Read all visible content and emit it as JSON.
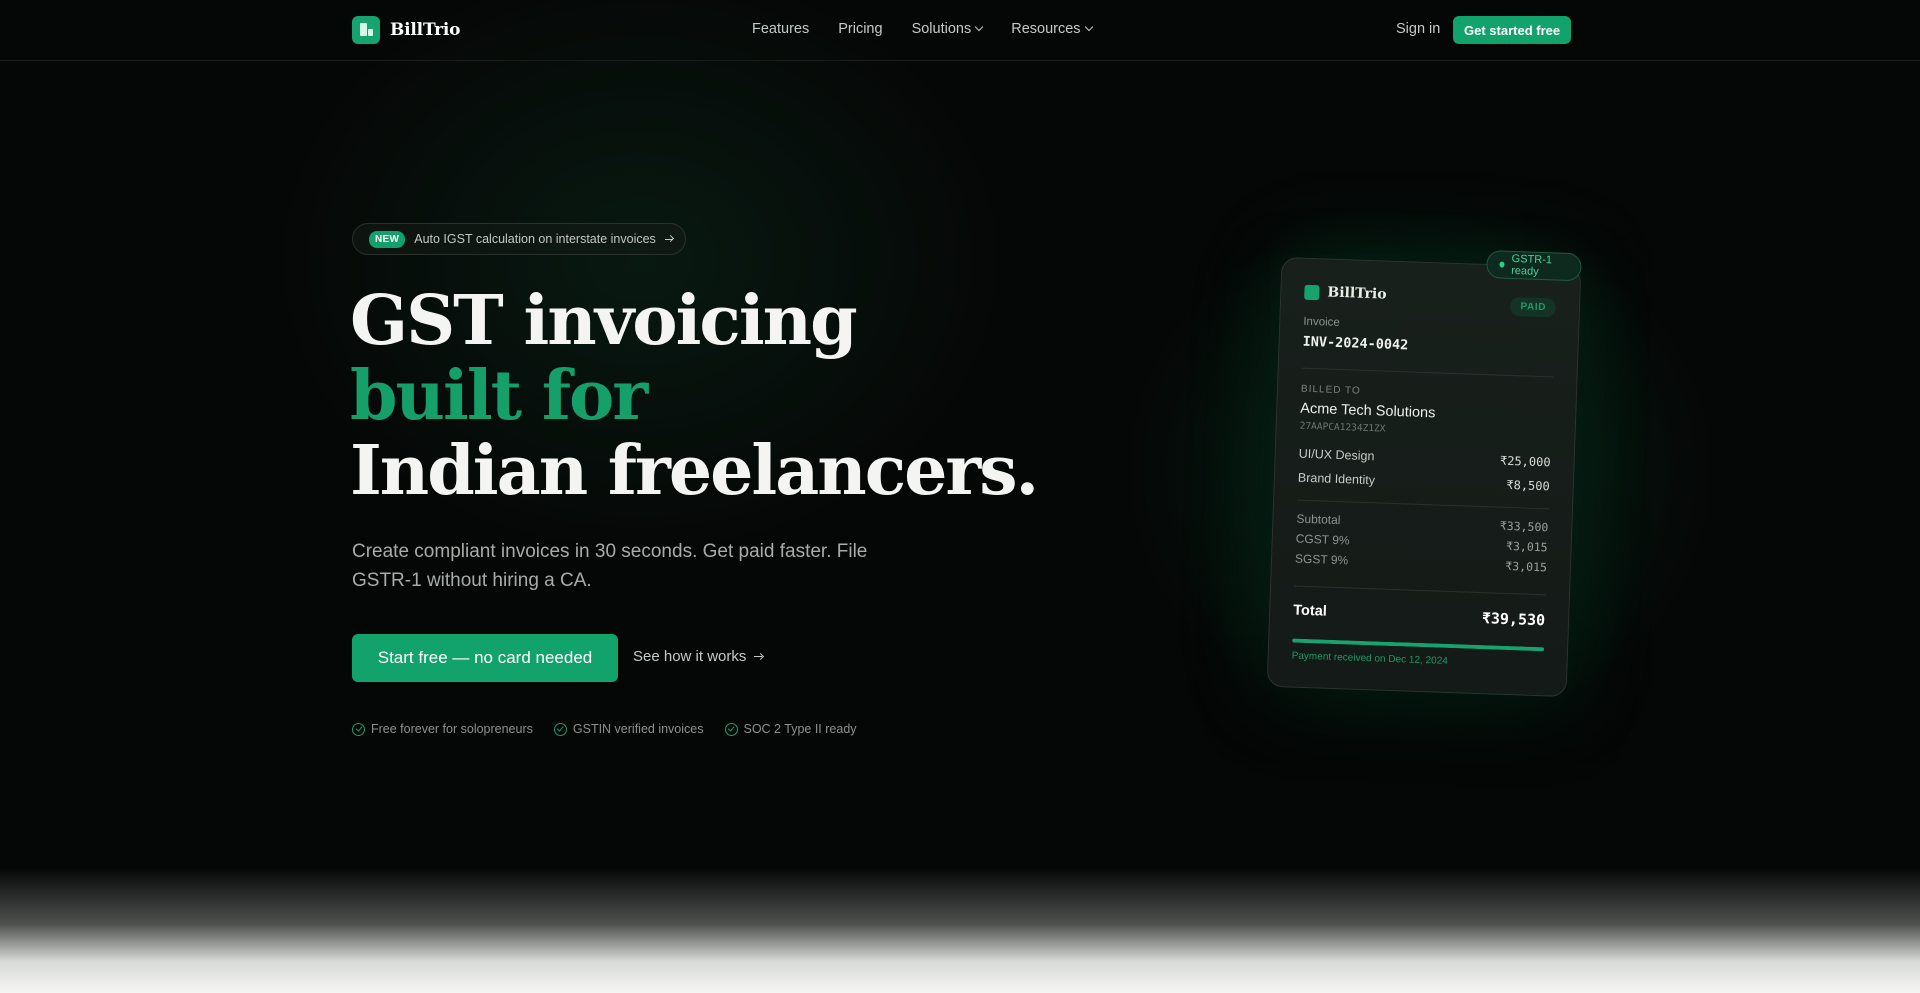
{
  "brand": {
    "name": "BillTrio",
    "logo_icon": "receipt-icon",
    "accent": "#12a36c"
  },
  "nav": {
    "links": [
      {
        "label": "Features"
      },
      {
        "label": "Pricing"
      },
      {
        "label": "Solutions",
        "has_menu": true
      },
      {
        "label": "Resources",
        "has_menu": true
      }
    ],
    "signin_label": "Sign in",
    "cta_label": "Get started free"
  },
  "hero": {
    "announcement": {
      "badge": "NEW",
      "text": "Auto IGST calculation on interstate invoices"
    },
    "headline": {
      "line1": "GST invoicing",
      "line2": "built for",
      "line3": "Indian freelancers."
    },
    "subcopy": "Create compliant invoices in 30 seconds. Get paid faster. File GSTR-1 without hiring a CA.",
    "primary_cta": "Start free — no card needed",
    "secondary_cta": "See how it works",
    "trust": [
      "Free forever for solopreneurs",
      "GSTIN verified invoices",
      "SOC 2 Type II ready"
    ]
  },
  "invoice_card": {
    "gstr_badge": "GSTR-1 ready",
    "brand": "BillTrio",
    "status": "PAID",
    "invoice_label": "Invoice",
    "invoice_number": "INV-2024-0042",
    "billed_to_label": "BILLED TO",
    "client_name": "Acme Tech Solutions",
    "client_gstin": "27AAPCA1234Z1ZX",
    "items": [
      {
        "name": "UI/UX Design",
        "amount": "₹25,000"
      },
      {
        "name": "Brand Identity",
        "amount": "₹8,500"
      }
    ],
    "subtotal_label": "Subtotal",
    "subtotal": "₹33,500",
    "cgst_label": "CGST 9%",
    "cgst": "₹3,015",
    "sgst_label": "SGST 9%",
    "sgst": "₹3,015",
    "total_label": "Total",
    "total": "₹39,530",
    "payment_progress": 1.0,
    "payment_note": "Payment received on Dec 12, 2024"
  }
}
